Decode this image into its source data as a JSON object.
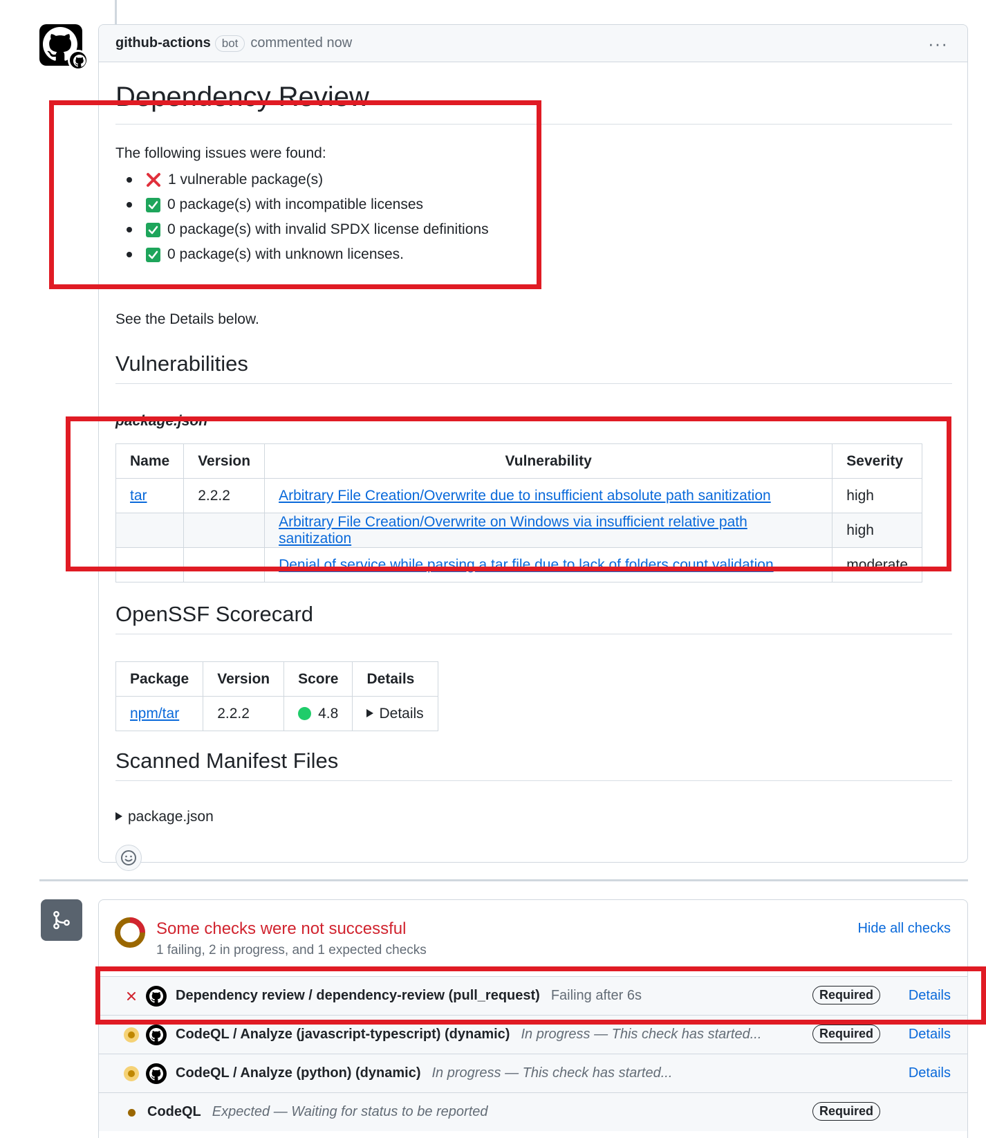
{
  "comment": {
    "author": "github-actions",
    "bot_label": "bot",
    "when": "commented now",
    "menu": "···"
  },
  "review": {
    "title": "Dependency Review",
    "intro": "The following issues were found:",
    "issues": [
      {
        "status": "fail",
        "text": "1 vulnerable package(s)"
      },
      {
        "status": "pass",
        "text": "0 package(s) with incompatible licenses"
      },
      {
        "status": "pass",
        "text": "0 package(s) with invalid SPDX license definitions"
      },
      {
        "status": "pass",
        "text": "0 package(s) with unknown licenses."
      }
    ],
    "see_below": "See the Details below."
  },
  "vulnerabilities": {
    "heading": "Vulnerabilities",
    "manifest": "package.json",
    "columns": [
      "Name",
      "Version",
      "Vulnerability",
      "Severity"
    ],
    "rows": [
      {
        "name": "tar",
        "version": "2.2.2",
        "vulnerability": "Arbitrary File Creation/Overwrite due to insufficient absolute path sanitization",
        "severity": "high"
      },
      {
        "name": "",
        "version": "",
        "vulnerability": "Arbitrary File Creation/Overwrite on Windows via insufficient relative path sanitization",
        "severity": "high"
      },
      {
        "name": "",
        "version": "",
        "vulnerability": "Denial of service while parsing a tar file due to lack of folders count validation",
        "severity": "moderate"
      }
    ]
  },
  "scorecard": {
    "heading": "OpenSSF Scorecard",
    "columns": [
      "Package",
      "Version",
      "Score",
      "Details"
    ],
    "row": {
      "package": "npm/tar",
      "version": "2.2.2",
      "score": "4.8",
      "details": "Details"
    },
    "score_color": "#1fcc6a"
  },
  "scanned": {
    "heading": "Scanned Manifest Files",
    "file": "package.json"
  },
  "checks": {
    "title": "Some checks were not successful",
    "subtitle": "1 failing, 2 in progress, and 1 expected checks",
    "hide_all": "Hide all checks",
    "items": [
      {
        "status": "failing",
        "name": "Dependency review / dependency-review (pull_request)",
        "desc": "Failing after 6s",
        "required": "Required",
        "details": "Details"
      },
      {
        "status": "in-progress",
        "name": "CodeQL / Analyze (javascript-typescript) (dynamic)",
        "desc": "In progress — This check has started...",
        "required": "Required",
        "details": "Details"
      },
      {
        "status": "in-progress",
        "name": "CodeQL / Analyze (python) (dynamic)",
        "desc": "In progress — This check has started...",
        "required": "",
        "details": "Details"
      },
      {
        "status": "expected",
        "name": "CodeQL",
        "desc": "Expected — Waiting for status to be reported",
        "required": "Required",
        "details": ""
      }
    ]
  },
  "colors": {
    "fail_red": "#d1242f",
    "annotation_red": "#e01b24",
    "link_blue": "#0969da",
    "pass_green": "#1ea55b",
    "pending_yellow": "#bf8700"
  }
}
